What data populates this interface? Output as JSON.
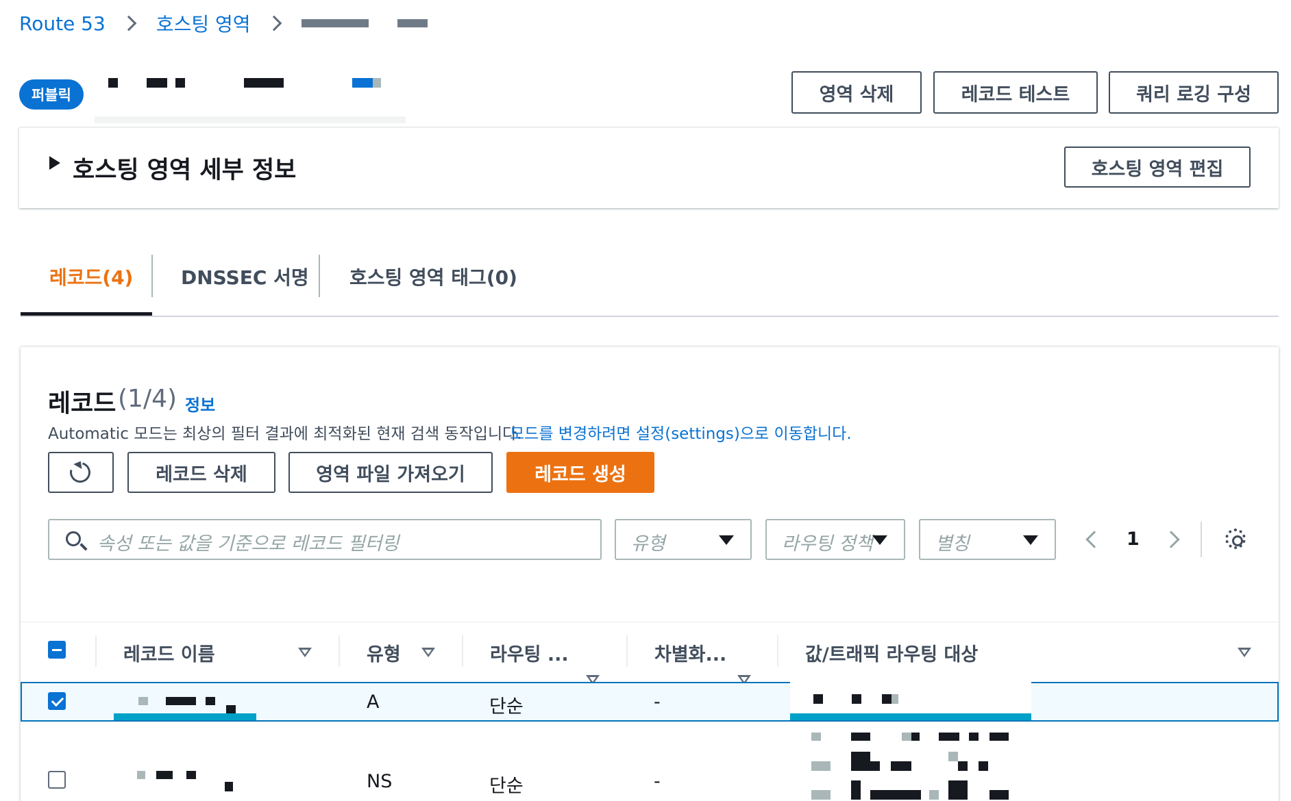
{
  "breadcrumb": {
    "items": [
      "Route 53",
      "호스팅 영역"
    ]
  },
  "header": {
    "badge": "퍼블릭",
    "actions": {
      "delete_zone": "영역 삭제",
      "test_record": "레코드 테스트",
      "query_logging": "쿼리 로깅 구성"
    }
  },
  "details": {
    "title": "호스팅 영역 세부 정보",
    "edit_button": "호스팅 영역 편집"
  },
  "tabs": [
    {
      "label": "레코드(4)",
      "active": true
    },
    {
      "label": "DNSSEC 서명",
      "active": false
    },
    {
      "label": "호스팅 영역 태그(0)",
      "active": false
    }
  ],
  "records": {
    "title": "레코드",
    "count": "(1/4)",
    "info_link": "정보",
    "description": "Automatic 모드는 최상의 필터 결과에 최적화된 현재 검색 동작입니다.",
    "description_link": "모드를 변경하려면 설정(settings)으로 이동합니다.",
    "buttons": {
      "delete": "레코드 삭제",
      "import": "영역 파일 가져오기",
      "create": "레코드 생성"
    },
    "filter": {
      "search_placeholder": "속성 또는 값을 기준으로 레코드 필터링",
      "type_placeholder": "유형",
      "routing_placeholder": "라우팅 정책",
      "alias_placeholder": "별칭"
    },
    "pagination": {
      "current_page": "1"
    },
    "columns": [
      "레코드 이름",
      "유형",
      "라우팅 ...",
      "차별화...",
      "값/트래픽 라우팅 대상"
    ],
    "rows": [
      {
        "type": "A",
        "routing": "단순",
        "differentiator": "-",
        "selected": true
      },
      {
        "type": "NS",
        "routing": "단순",
        "differentiator": "-",
        "selected": false
      }
    ]
  },
  "colors": {
    "link": "#0972d3",
    "primary": "#ec7211",
    "selected_border": "#0073bb",
    "highlight": "#00a1c9"
  }
}
